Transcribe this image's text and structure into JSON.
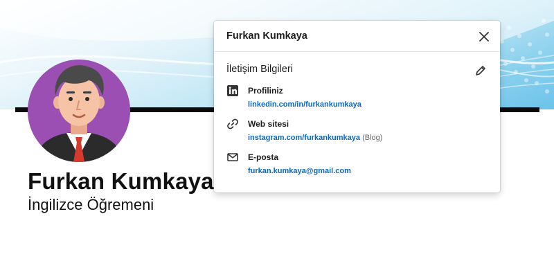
{
  "profile": {
    "name": "Furkan Kumkaya",
    "title": "İngilizce Öğremeni"
  },
  "modal": {
    "title": "Furkan Kumkaya",
    "section_title": "İletişim Bilgileri",
    "items": [
      {
        "icon": "linkedin-icon",
        "label": "Profiliniz",
        "value": "linkedin.com/in/furkankumkaya",
        "note": ""
      },
      {
        "icon": "link-icon",
        "label": "Web sitesi",
        "value": "instagram.com/furkankumkaya",
        "note": "(Blog)"
      },
      {
        "icon": "envelope-icon",
        "label": "E-posta",
        "value": "furkan.kumkaya@gmail.com",
        "note": ""
      }
    ]
  },
  "colors": {
    "link": "#0a66c2",
    "avatar_bg": "#9b4fb3",
    "banner_accent": "#6cc3ea",
    "divider_bar": "#0a0a0a"
  }
}
